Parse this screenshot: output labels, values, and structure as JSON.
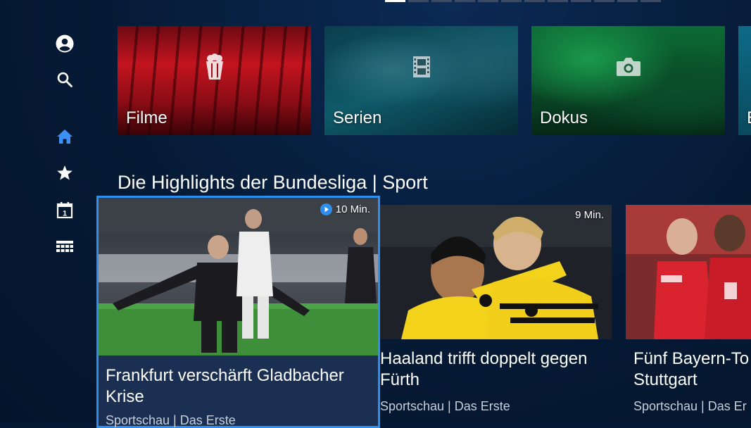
{
  "pager": {
    "count": 12,
    "active_index": 0
  },
  "sidebar": {
    "items": [
      {
        "name": "profile-icon",
        "active": false
      },
      {
        "name": "search-icon",
        "active": false
      },
      {
        "name": "home-icon",
        "active": true
      },
      {
        "name": "star-icon",
        "active": false
      },
      {
        "name": "calendar-icon",
        "active": false,
        "label": "1"
      },
      {
        "name": "grid-icon",
        "active": false
      }
    ]
  },
  "categories": [
    {
      "label": "Filme",
      "icon": "popcorn-icon",
      "color": "#c0141f"
    },
    {
      "label": "Serien",
      "icon": "film-strip-icon",
      "color": "#0f6b80"
    },
    {
      "label": "Dokus",
      "icon": "camera-icon",
      "color": "#0e7a3a"
    },
    {
      "label": "E",
      "icon": "",
      "color": "#0e5f7a"
    }
  ],
  "section": {
    "title": "Die Highlights der Bundesliga | Sport"
  },
  "cards": [
    {
      "duration": "10 Min.",
      "title": "Frankfurt verschärft Gladbacher Krise",
      "subtitle": "Sportschau | Das Erste",
      "focused": true
    },
    {
      "duration": "9 Min.",
      "title": "Haaland trifft doppelt gegen Fürth",
      "subtitle": "Sportschau | Das Erste",
      "focused": false
    },
    {
      "duration": "",
      "title": "Fünf Bayern-To Stuttgart",
      "subtitle": "Sportschau | Das Er",
      "focused": false
    }
  ],
  "colors": {
    "background": "#061a35",
    "accent": "#2f8ff0",
    "focus_card": "#1a2f52"
  }
}
